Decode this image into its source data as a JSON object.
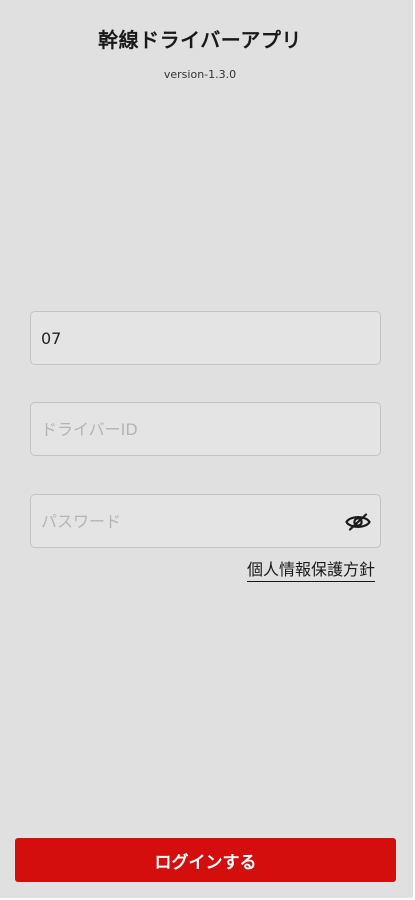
{
  "header": {
    "title": "幹線ドライバーアプリ",
    "version": "version-1.3.0"
  },
  "form": {
    "company_code": {
      "value": "07",
      "placeholder": ""
    },
    "driver_id": {
      "value": "",
      "placeholder": "ドライバーID"
    },
    "password": {
      "value": "",
      "placeholder": "パスワード",
      "toggle_icon": "eye-icon"
    },
    "privacy_link_label": "個人情報保護方針",
    "login_label": "ログインする"
  },
  "colors": {
    "background": "#e0e0e0",
    "primary_button": "#d40d0d",
    "field_border": "#c3c3c3",
    "placeholder": "#b4b4b4"
  }
}
